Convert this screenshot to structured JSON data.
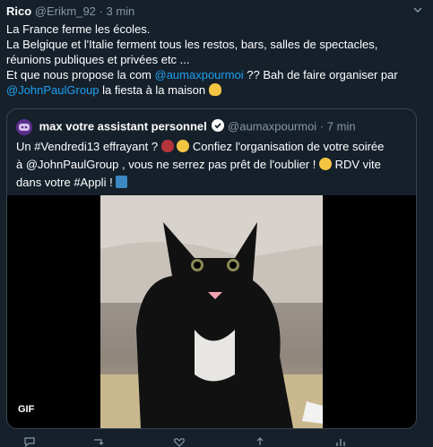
{
  "tweet": {
    "author_name": "Rico",
    "author_handle": "@Erikm_92",
    "separator": "·",
    "time": "3 min",
    "lines": [
      "La France ferme les écoles.",
      "La Belgique et l'Italie ferment tous les restos, bars, salles de spectacles,",
      "réunions publiques et privées etc ..."
    ],
    "line4_prefix": "Et que nous propose la com ",
    "mention_1": "@aumaxpourmoi",
    "line4_suffix": " ?? Bah de faire organiser par",
    "mention_2": "@JohnPaulGroup",
    "line5_suffix": " la fiesta à la maison "
  },
  "quote": {
    "author_name": "max votre assistant personnel",
    "author_handle": "@aumaxpourmoi",
    "separator": "·",
    "time": "7 min",
    "line1_prefix": "Un #Vendredi13 effrayant ? ",
    "line1_suffix": " Confiez l'organisation de votre soirée",
    "line2": "à @JohnPaulGroup , vous ne serrez pas prêt de l'oublier ! ",
    "line2_suffix": " RDV vite",
    "line3": "dans votre #Appli ! ",
    "media_label": "GIF"
  },
  "icons": [
    "chevron-down-icon",
    "verified-icon",
    "devil-emoji",
    "scared-emoji",
    "relieved-emoji",
    "phone-arrow-emoji",
    "facepalm-emoji",
    "reply-icon",
    "retweet-icon",
    "like-icon",
    "share-icon"
  ],
  "colors": {
    "background": "#15202b",
    "link": "#1da1f2",
    "muted": "#8899a6",
    "border": "#38444d"
  }
}
